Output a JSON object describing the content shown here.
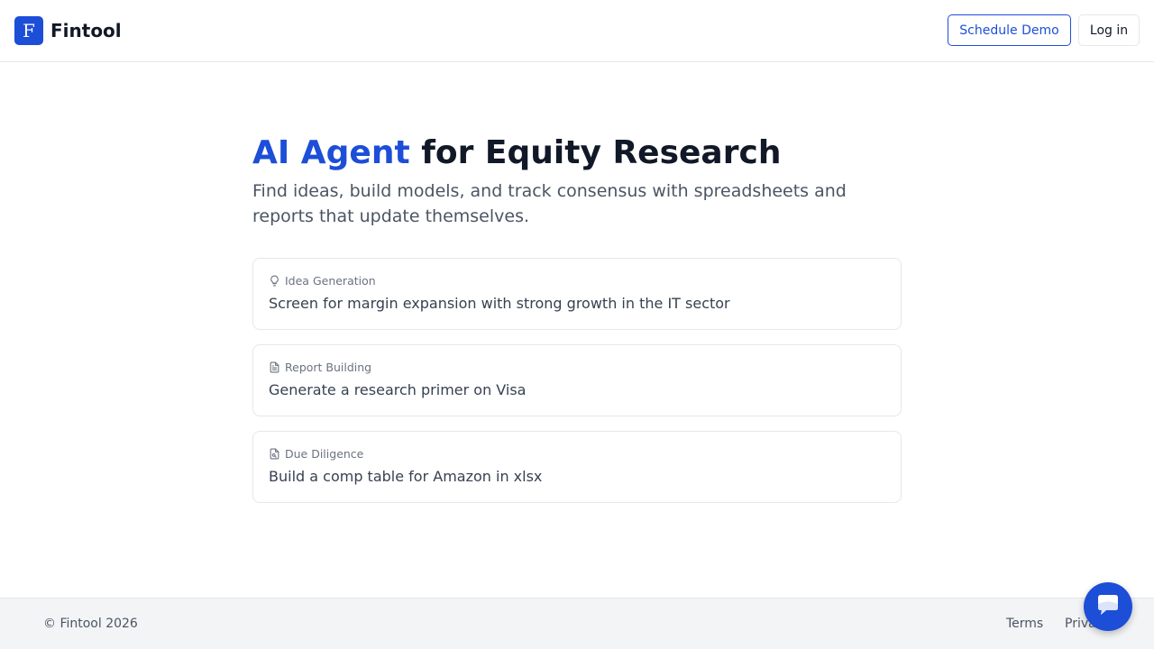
{
  "header": {
    "logo_letter": "F",
    "brand": "Fintool",
    "schedule_demo_label": "Schedule Demo",
    "login_label": "Log in"
  },
  "hero": {
    "title_accent": "AI Agent",
    "title_rest": "for Equity Research",
    "subtitle": "Find ideas, build models, and track consensus with spreadsheets and reports that update themselves."
  },
  "cards": [
    {
      "tag": "Idea Generation",
      "icon": "lightbulb-icon",
      "text": "Screen for margin expansion with strong growth in the IT sector"
    },
    {
      "tag": "Report Building",
      "icon": "document-icon",
      "text": "Generate a research primer on Visa"
    },
    {
      "tag": "Due Diligence",
      "icon": "file-search-icon",
      "text": "Build a comp table for Amazon in xlsx"
    }
  ],
  "footer": {
    "copyright": "© Fintool 2026",
    "terms_label": "Terms",
    "privacy_label": "Privacy"
  },
  "chat": {
    "icon": "chat-icon"
  },
  "colors": {
    "accent": "#1d4ed8",
    "text": "#111827",
    "muted": "#6b7280",
    "footer_bg": "#f3f4f6"
  }
}
